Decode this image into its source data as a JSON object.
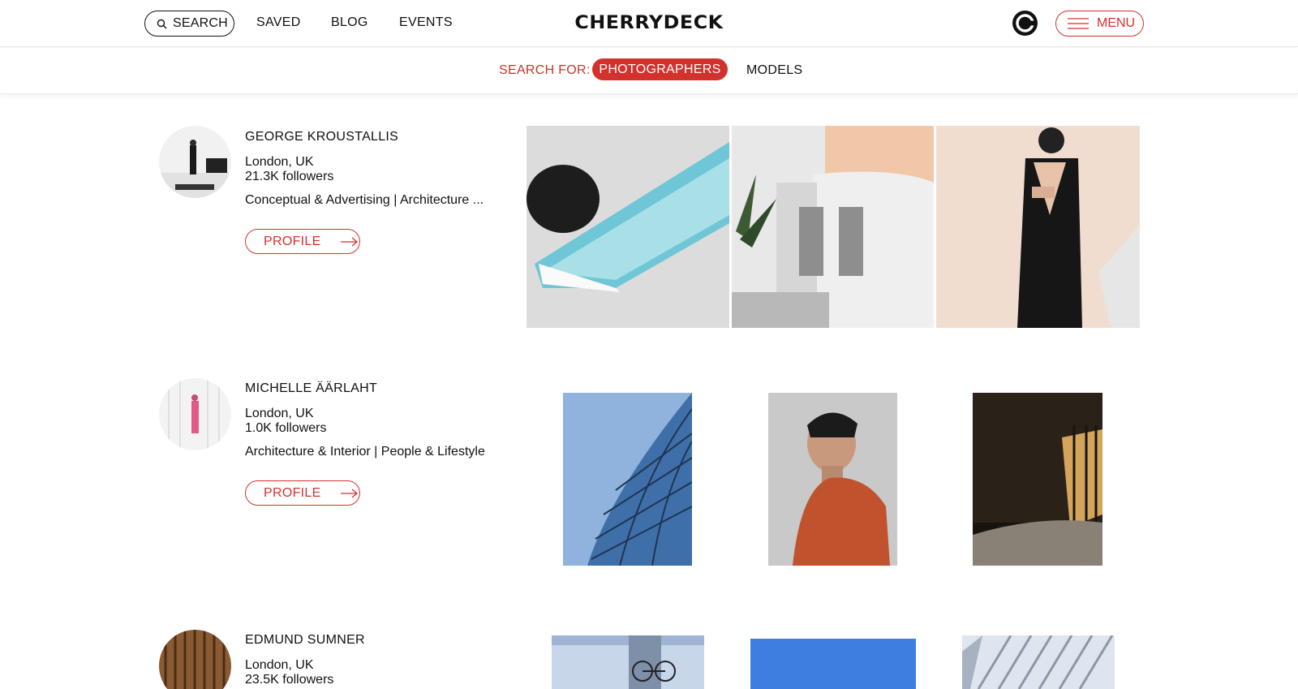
{
  "header": {
    "search_label": "SEARCH",
    "nav": [
      "SAVED",
      "BLOG",
      "EVENTS"
    ],
    "logo": "CHERRYDECK",
    "menu_label": "MENU"
  },
  "subbar": {
    "search_for": "SEARCH FOR:",
    "options": [
      "PHOTOGRAPHERS",
      "MODELS"
    ],
    "active": "PHOTOGRAPHERS"
  },
  "colors": {
    "accent": "#d3312c",
    "text": "#111111"
  },
  "photographers": [
    {
      "name": "GEORGE KROUSTALLIS",
      "location": "London, UK",
      "followers": "21.3K followers",
      "categories": "Conceptual & Advertising | Architecture ...",
      "profile_label": "PROFILE"
    },
    {
      "name": "MICHELLE ÄÄRLAHT",
      "location": "London, UK",
      "followers": "1.0K followers",
      "categories": "Architecture & Interior | People & Lifestyle",
      "profile_label": "PROFILE"
    },
    {
      "name": "EDMUND SUMNER",
      "location": "London, UK",
      "followers": "23.5K followers"
    }
  ],
  "icons": [
    "search-icon",
    "c-logo-icon",
    "hamburger-icon",
    "arrow-right-icon"
  ]
}
